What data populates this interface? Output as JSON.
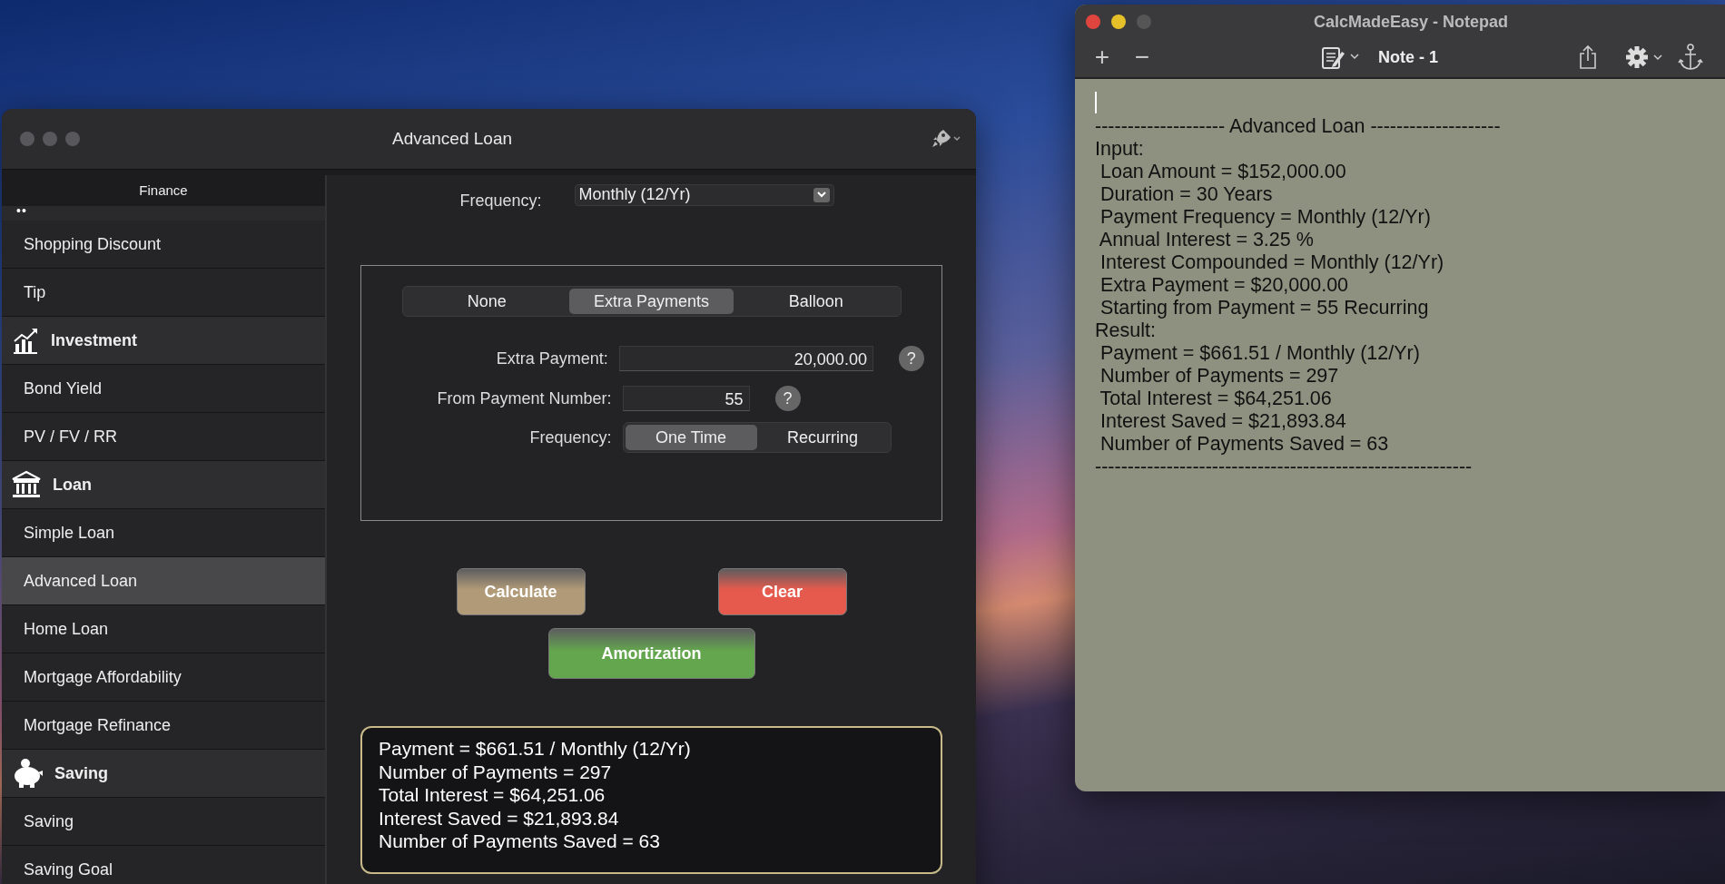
{
  "calculator_window": {
    "title": "Advanced Loan",
    "sidebar": {
      "header": "Finance",
      "indicator": "••",
      "items": [
        {
          "label": "Shopping Discount",
          "kind": "item",
          "selected": false
        },
        {
          "label": "Tip",
          "kind": "item",
          "selected": false
        },
        {
          "label": "Investment",
          "kind": "category",
          "selected": false
        },
        {
          "label": "Bond Yield",
          "kind": "item",
          "selected": false
        },
        {
          "label": "PV / FV / RR",
          "kind": "item",
          "selected": false
        },
        {
          "label": "Loan",
          "kind": "category",
          "selected": false
        },
        {
          "label": "Simple Loan",
          "kind": "item",
          "selected": false
        },
        {
          "label": "Advanced Loan",
          "kind": "item",
          "selected": true
        },
        {
          "label": "Home Loan",
          "kind": "item",
          "selected": false
        },
        {
          "label": "Mortgage Affordability",
          "kind": "item",
          "selected": false
        },
        {
          "label": "Mortgage Refinance",
          "kind": "item",
          "selected": false
        },
        {
          "label": "Saving",
          "kind": "category",
          "selected": false
        },
        {
          "label": "Saving",
          "kind": "item",
          "selected": false
        },
        {
          "label": "Saving Goal",
          "kind": "item",
          "selected": false
        }
      ]
    },
    "frequency_row": {
      "label": "Frequency:",
      "value": "Monthly (12/Yr)"
    },
    "options": [
      {
        "label": "None",
        "selected": false
      },
      {
        "label": "Extra Payments",
        "selected": true
      },
      {
        "label": "Balloon",
        "selected": false
      }
    ],
    "extra_payment": {
      "label": "Extra Payment:",
      "value": "20,000.00",
      "help": "?"
    },
    "from_payment": {
      "label": "From Payment Number:",
      "value": "55",
      "help": "?"
    },
    "payment_frequency": {
      "label": "Frequency:",
      "options": [
        {
          "label": "One Time",
          "selected": true
        },
        {
          "label": "Recurring",
          "selected": false
        }
      ]
    },
    "buttons": [
      {
        "label": "Calculate",
        "color": "#b09a78"
      },
      {
        "label": "Clear",
        "color": "#e55a4c"
      },
      {
        "label": "Amortization",
        "color": "#63a64e"
      }
    ],
    "result": [
      "Payment = $661.51 / Monthly (12/Yr)",
      "Number of Payments = 297",
      "Total Interest = $64,251.06",
      "Interest Saved = $21,893.84",
      "Number of Payments Saved = 63"
    ]
  },
  "notepad_window": {
    "title": "CalcMadeEasy - Notepad",
    "toolbar": {
      "add": "+",
      "remove": "−",
      "note_title": "Note - 1"
    },
    "lines": [
      "-------------------- Advanced Loan --------------------",
      "Input:",
      " Loan Amount = $152,000.00",
      " Duration = 30 Years",
      " Payment Frequency = Monthly (12/Yr)",
      " Annual Interest = 3.25 %",
      " Interest Compounded = Monthly (12/Yr)",
      " Extra Payment = $20,000.00",
      " Starting from Payment = 55 Recurring",
      "Result:",
      " Payment = $661.51 / Monthly (12/Yr)",
      " Number of Payments = 297",
      " Total Interest = $64,251.06",
      " Interest Saved = $21,893.84",
      " Number of Payments Saved = 63",
      "----------------------------------------------------------"
    ]
  }
}
